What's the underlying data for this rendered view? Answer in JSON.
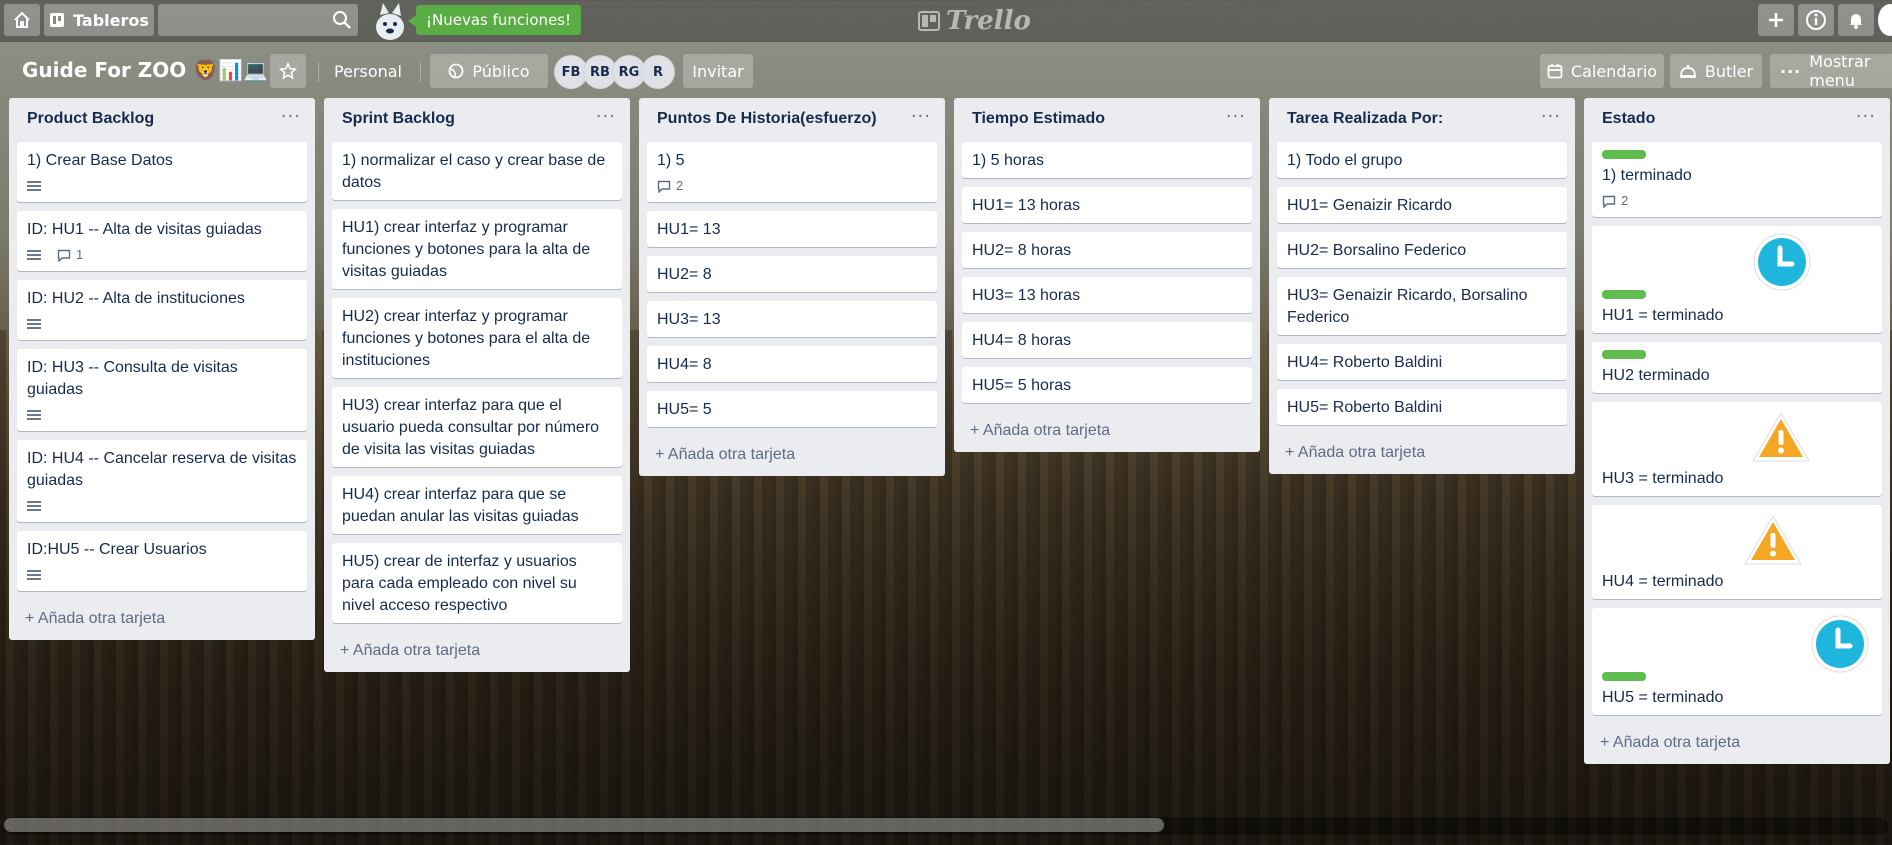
{
  "topbar": {
    "boards_label": "Tableros",
    "news_label": "¡Nuevas funciones!",
    "logo_text": "Trello"
  },
  "board": {
    "title": "Guide For ZOO 🦁📊💻",
    "team_label": "Personal",
    "visibility_label": "Público",
    "invite_label": "Invitar",
    "calendar_label": "Calendario",
    "butler_label": "Butler",
    "menu_label": "Mostrar menu",
    "members": [
      "FB",
      "RB",
      "RG",
      "R"
    ]
  },
  "lists": [
    {
      "title": "Product Backlog",
      "add_label": "Añada otra tarjeta",
      "cards": [
        {
          "text": "1) Crear Base Datos",
          "desc": true
        },
        {
          "text": "ID: HU1 -- Alta de visitas guiadas",
          "desc": true,
          "comments": "1"
        },
        {
          "text": "ID: HU2 -- Alta de instituciones",
          "desc": true
        },
        {
          "text": "ID: HU3 -- Consulta de visitas guiadas",
          "desc": true
        },
        {
          "text": "ID: HU4 -- Cancelar reserva de visitas guiadas",
          "desc": true
        },
        {
          "text": "ID:HU5 -- Crear Usuarios",
          "desc": true
        }
      ]
    },
    {
      "title": "Sprint Backlog",
      "add_label": "Añada otra tarjeta",
      "cards": [
        {
          "text": "1) normalizar el caso y crear base de datos"
        },
        {
          "text": "HU1) crear interfaz y programar funciones y botones para la alta de visitas guiadas"
        },
        {
          "text": "HU2) crear interfaz y programar funciones y botones para el alta de instituciones"
        },
        {
          "text": "HU3) crear interfaz para que el usuario pueda consultar por número de visita las visitas guiadas"
        },
        {
          "text": "HU4) crear interfaz para que se puedan anular las visitas guiadas"
        },
        {
          "text": "HU5) crear de interfaz y usuarios para cada empleado con nivel su nivel acceso respectivo"
        }
      ]
    },
    {
      "title": "Puntos De Historia(esfuerzo)",
      "add_label": "Añada otra tarjeta",
      "cards": [
        {
          "text": "1) 5",
          "comments": "2"
        },
        {
          "text": "HU1= 13"
        },
        {
          "text": "HU2= 8"
        },
        {
          "text": "HU3= 13"
        },
        {
          "text": "HU4= 8"
        },
        {
          "text": "HU5= 5"
        }
      ]
    },
    {
      "title": "Tiempo Estimado",
      "add_label": "Añada otra tarjeta",
      "cards": [
        {
          "text": "1) 5 horas"
        },
        {
          "text": "HU1= 13 horas"
        },
        {
          "text": "HU2= 8 horas"
        },
        {
          "text": "HU3= 13 horas"
        },
        {
          "text": "HU4= 8 horas"
        },
        {
          "text": "HU5= 5 horas"
        }
      ]
    },
    {
      "title": "Tarea Realizada Por:",
      "add_label": "Añada otra tarjeta",
      "cards": [
        {
          "text": "1) Todo el grupo"
        },
        {
          "text": "HU1= Genaizir Ricardo"
        },
        {
          "text": "HU2= Borsalino Federico"
        },
        {
          "text": "HU3= Genaizir Ricardo, Borsalino Federico"
        },
        {
          "text": "HU4= Roberto Baldini"
        },
        {
          "text": "HU5= Roberto Baldini"
        }
      ]
    },
    {
      "title": "Estado",
      "add_label": "Añada otra tarjeta",
      "cards": [
        {
          "text": "1) terminado",
          "label": "green",
          "comments": "2"
        },
        {
          "text": "HU1 = terminado",
          "label": "green",
          "sticker": "clock"
        },
        {
          "text": "HU2 terminado",
          "label": "green"
        },
        {
          "text": "HU3 = terminado",
          "sticker": "warning"
        },
        {
          "text": "HU4 = terminado",
          "sticker": "warning"
        },
        {
          "text": "HU5 = terminado",
          "label": "green",
          "sticker": "clock"
        }
      ]
    }
  ],
  "colors": {
    "label_green": "#61bd4f",
    "news_green": "#5aac44",
    "list_bg": "#ebecf0",
    "card_text": "#172b4d"
  }
}
